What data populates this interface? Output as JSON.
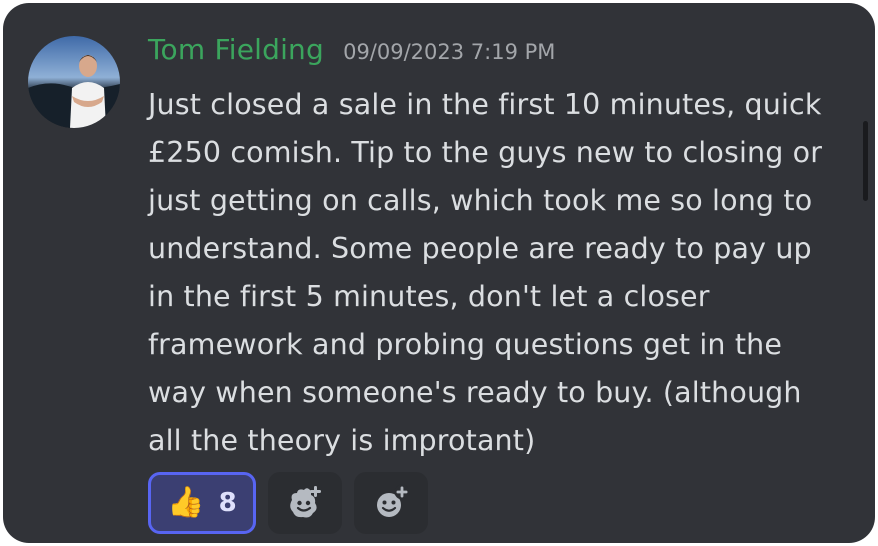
{
  "message": {
    "author": "Tom Fielding",
    "timestamp": "09/09/2023 7:19 PM",
    "lines": [
      "Just closed a sale in the first 10 minutes, quick",
      "£250 comish. Tip to the guys new to closing or",
      "just getting on calls, which took me so long to",
      "understand. Some people are ready to pay up",
      "in the first 5 minutes, don't let a closer",
      "framework and probing questions get in the",
      "way when someone's ready to buy. (although",
      "all the theory is improtant)"
    ]
  },
  "reactions": {
    "thumbs_up": {
      "emoji": "👍",
      "count": "8",
      "icon": "thumbs-up-emoji"
    },
    "add_reaction_icon": "add-reaction-icon",
    "add_super_reaction_icon": "add-super-reaction-icon"
  },
  "colors": {
    "background": "#313338",
    "author": "#3ba55d",
    "text": "#dbdee1",
    "timestamp": "#a3a6aa",
    "reaction_active_bg": "#3b3f72",
    "reaction_active_border": "#5865f2"
  }
}
